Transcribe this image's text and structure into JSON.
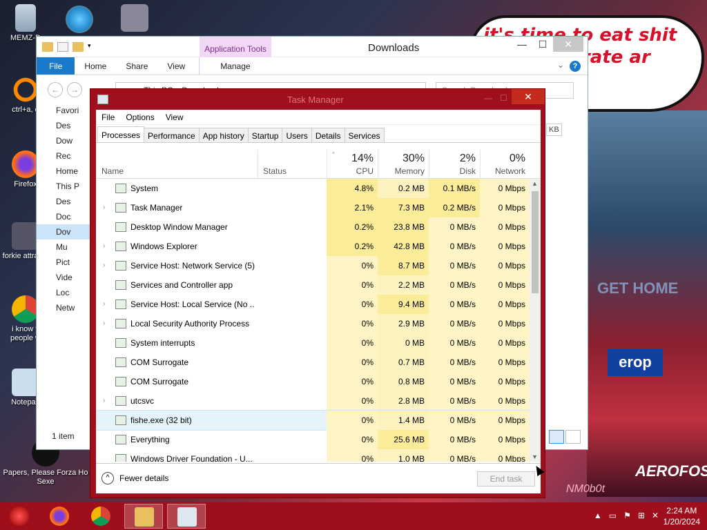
{
  "wallpaper": {
    "bubble_text": "it's time to eat shit and celebrate ar",
    "sign_text": "erop",
    "sign2_text": "AEROFOS",
    "get_home_text": "GET HOME",
    "watermark": "NM0b0t"
  },
  "desktop_icons": [
    {
      "label": "MEMZ-D",
      "name": "recycle-bin-icon"
    },
    {
      "label": "ctrl+a, e",
      "name": "shortcut-icon"
    },
    {
      "label": "Firefox",
      "name": "firefox-icon"
    },
    {
      "label": "forkie attracta",
      "name": "settings-shortcut-icon"
    },
    {
      "label": "i know y people w",
      "name": "chrome-icon"
    },
    {
      "label": "Notepad",
      "name": "notepad-icon"
    },
    {
      "label": "Papers, Please Forza Ho Sexe",
      "name": "game-shortcut-icon"
    }
  ],
  "explorer": {
    "title": "Downloads",
    "app_tools": "Application Tools",
    "ribbon_tabs": [
      "File",
      "Home",
      "Share",
      "View",
      "Manage"
    ],
    "path": [
      "This PC",
      "Downloads"
    ],
    "search_placeholder": "Search Downloads",
    "nav_items": [
      "Favori",
      "Des",
      "Dow",
      "Rec",
      "Home",
      "This P",
      "Des",
      "Doc",
      "Dov",
      "Mu",
      "Pict",
      "Vide",
      "Loc",
      "Netw"
    ],
    "status": "1 item",
    "size_hint": "KB",
    "help_label": "?"
  },
  "taskmgr": {
    "title": "Task Manager",
    "menu": [
      "File",
      "Options",
      "View"
    ],
    "tabs": [
      "Processes",
      "Performance",
      "App history",
      "Startup",
      "Users",
      "Details",
      "Services"
    ],
    "active_tab": "Processes",
    "columns": {
      "name": "Name",
      "status": "Status",
      "cpu_pct": "14%",
      "cpu": "CPU",
      "mem_pct": "30%",
      "mem": "Memory",
      "disk_pct": "2%",
      "disk": "Disk",
      "net_pct": "0%",
      "net": "Network"
    },
    "processes": [
      {
        "name": "System",
        "expand": false,
        "cpu": "4.8%",
        "mem": "0.2 MB",
        "disk": "0.1 MB/s",
        "net": "0 Mbps",
        "icon": "system-process-icon"
      },
      {
        "name": "Task Manager",
        "expand": true,
        "cpu": "2.1%",
        "mem": "7.3 MB",
        "disk": "0.2 MB/s",
        "net": "0 Mbps",
        "icon": "task-manager-icon"
      },
      {
        "name": "Desktop Window Manager",
        "expand": false,
        "cpu": "0.2%",
        "mem": "23.8 MB",
        "disk": "0 MB/s",
        "net": "0 Mbps",
        "icon": "dwm-icon"
      },
      {
        "name": "Windows Explorer",
        "expand": true,
        "cpu": "0.2%",
        "mem": "42.8 MB",
        "disk": "0 MB/s",
        "net": "0 Mbps",
        "icon": "folder-icon"
      },
      {
        "name": "Service Host: Network Service (5)",
        "expand": true,
        "cpu": "0%",
        "mem": "8.7 MB",
        "disk": "0 MB/s",
        "net": "0 Mbps",
        "icon": "gear-icon"
      },
      {
        "name": "Services and Controller app",
        "expand": false,
        "cpu": "0%",
        "mem": "2.2 MB",
        "disk": "0 MB/s",
        "net": "0 Mbps",
        "icon": "services-icon"
      },
      {
        "name": "Service Host: Local Service (No ...",
        "expand": true,
        "cpu": "0%",
        "mem": "9.4 MB",
        "disk": "0 MB/s",
        "net": "0 Mbps",
        "icon": "gear-icon"
      },
      {
        "name": "Local Security Authority Process",
        "expand": true,
        "cpu": "0%",
        "mem": "2.9 MB",
        "disk": "0 MB/s",
        "net": "0 Mbps",
        "icon": "lsa-icon"
      },
      {
        "name": "System interrupts",
        "expand": false,
        "cpu": "0%",
        "mem": "0 MB",
        "disk": "0 MB/s",
        "net": "0 Mbps",
        "icon": "interrupts-icon"
      },
      {
        "name": "COM Surrogate",
        "expand": false,
        "cpu": "0%",
        "mem": "0.7 MB",
        "disk": "0 MB/s",
        "net": "0 Mbps",
        "icon": "com-surrogate-icon"
      },
      {
        "name": "COM Surrogate",
        "expand": false,
        "cpu": "0%",
        "mem": "0.8 MB",
        "disk": "0 MB/s",
        "net": "0 Mbps",
        "icon": "com-surrogate-icon"
      },
      {
        "name": "utcsvc",
        "expand": true,
        "cpu": "0%",
        "mem": "2.8 MB",
        "disk": "0 MB/s",
        "net": "0 Mbps",
        "icon": "gear-icon"
      },
      {
        "name": "fishe.exe (32 bit)",
        "expand": false,
        "cpu": "0%",
        "mem": "1.4 MB",
        "disk": "0 MB/s",
        "net": "0 Mbps",
        "icon": "fish-icon",
        "selected": true
      },
      {
        "name": "Everything",
        "expand": false,
        "cpu": "0%",
        "mem": "25.6 MB",
        "disk": "0 MB/s",
        "net": "0 Mbps",
        "icon": "search-magnifier-icon"
      },
      {
        "name": "Windows Driver Foundation - U...",
        "expand": false,
        "cpu": "0%",
        "mem": "1.0 MB",
        "disk": "0 MB/s",
        "net": "0 Mbps",
        "icon": "driver-icon"
      }
    ],
    "fewer_details": "Fewer details",
    "end_task": "End task"
  },
  "taskbar": {
    "items": [
      "start-orb-icon",
      "firefox-icon",
      "chrome-icon",
      "file-explorer-icon",
      "task-manager-icon"
    ],
    "time": "2:24 AM",
    "date": "1/20/2024"
  },
  "colors": {
    "tm_frame": "#a0101c",
    "taskbar": "#9e0e1b",
    "heat_high": "#fbec9a",
    "heat_low": "#fff4c6",
    "file_tab": "#1979ca"
  }
}
